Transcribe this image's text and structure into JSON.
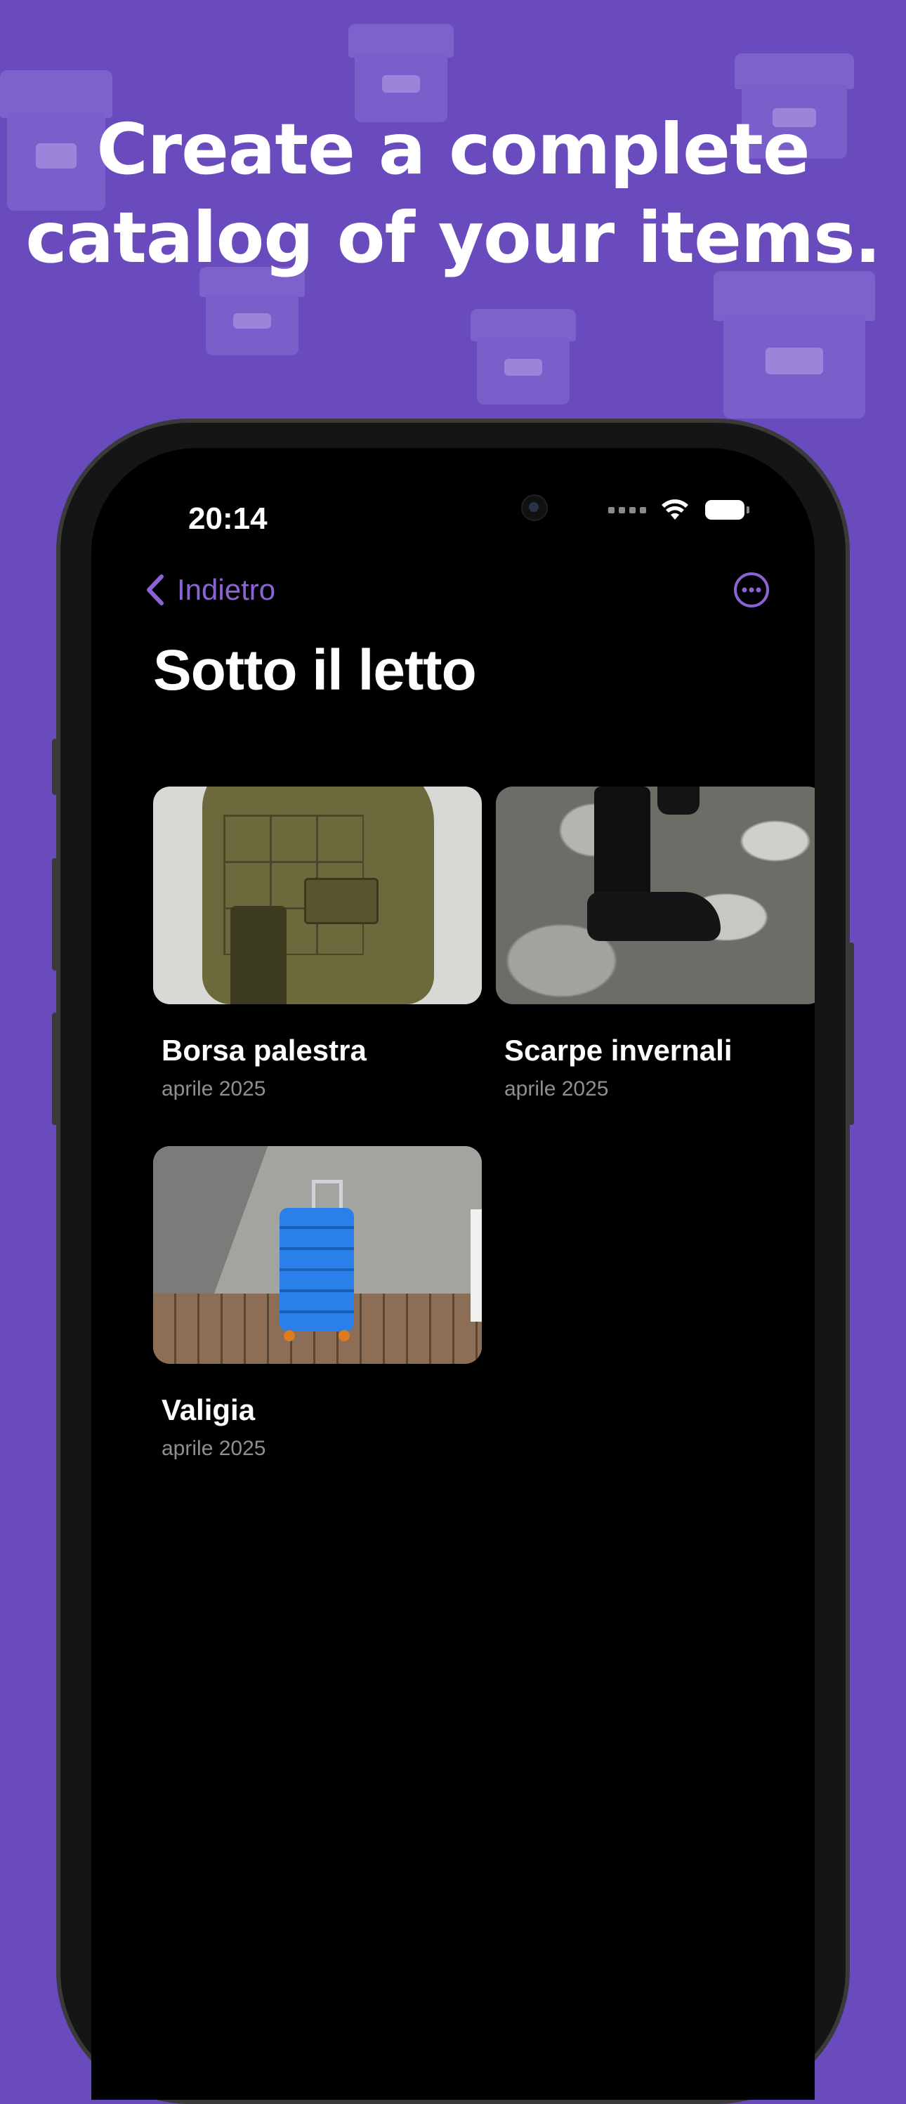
{
  "headline": {
    "line1": "Create a complete",
    "line2": "catalog of your items."
  },
  "status_bar": {
    "time": "20:14"
  },
  "nav": {
    "back_label": "Indietro",
    "more_icon": "ellipsis-circle-icon",
    "accent_color": "#8b63d4"
  },
  "page": {
    "title": "Sotto il letto"
  },
  "items": [
    {
      "name": "Borsa palestra",
      "date": "aprile 2025",
      "photo": "olive-backpack"
    },
    {
      "name": "Scarpe invernali",
      "date": "aprile 2025",
      "photo": "black-boot-on-ice"
    },
    {
      "name": "Valigia",
      "date": "aprile 2025",
      "photo": "blue-suitcase"
    }
  ],
  "colors": {
    "background": "#6a4bbd",
    "screen": "#000000",
    "secondary_text": "#8e8e93"
  }
}
